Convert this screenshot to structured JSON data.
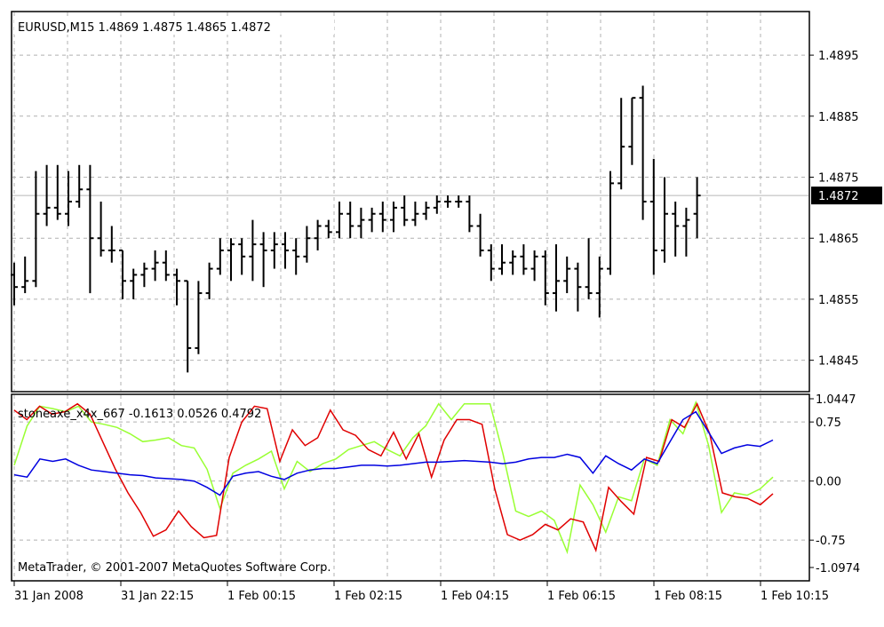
{
  "main_panel": {
    "title": "EURUSD,M15  1.4869 1.4875 1.4865 1.4872",
    "price_ticks": [
      "1.4895",
      "1.4885",
      "1.4875",
      "1.4865",
      "1.4855",
      "1.4845"
    ],
    "current_price": "1.4872"
  },
  "indicator_panel": {
    "title": "stoneaxe_x4x_667 -0.1613 0.0526 0.4792",
    "copyright": "MetaTrader, © 2001-2007 MetaQuotes Software Corp.",
    "ticks": [
      "1.0447",
      "0.75",
      "0.00",
      "-0.75",
      "-1.0974"
    ]
  },
  "time_axis": {
    "labels": [
      "31 Jan 2008",
      "31 Jan 22:15",
      "1 Feb 00:15",
      "1 Feb 02:15",
      "1 Feb 04:15",
      "1 Feb 06:15",
      "1 Feb 08:15",
      "1 Feb 10:15"
    ]
  },
  "colors": {
    "bars": "#000000",
    "grid": "#b0b0b0",
    "current_price_line": "#b8b8b8",
    "red_line": "#e00000",
    "green_line": "#99ff33",
    "blue_line": "#0000e0"
  },
  "chart_data": [
    {
      "type": "ohlc",
      "symbol": "EURUSD",
      "timeframe": "M15",
      "ylim": [
        1.484,
        1.4902
      ],
      "grid": true,
      "bars": [
        {
          "o": 1.4859,
          "h": 1.4861,
          "l": 1.4854,
          "c": 1.4857
        },
        {
          "o": 1.4857,
          "h": 1.4862,
          "l": 1.4856,
          "c": 1.4858
        },
        {
          "o": 1.4858,
          "h": 1.4876,
          "l": 1.4857,
          "c": 1.4869
        },
        {
          "o": 1.4869,
          "h": 1.4877,
          "l": 1.4867,
          "c": 1.487
        },
        {
          "o": 1.487,
          "h": 1.4877,
          "l": 1.4868,
          "c": 1.4869
        },
        {
          "o": 1.4869,
          "h": 1.4876,
          "l": 1.4867,
          "c": 1.4871
        },
        {
          "o": 1.4871,
          "h": 1.4877,
          "l": 1.487,
          "c": 1.4873
        },
        {
          "o": 1.4873,
          "h": 1.4877,
          "l": 1.4856,
          "c": 1.4865
        },
        {
          "o": 1.4865,
          "h": 1.4871,
          "l": 1.4862,
          "c": 1.4863
        },
        {
          "o": 1.4863,
          "h": 1.4867,
          "l": 1.4861,
          "c": 1.4863
        },
        {
          "o": 1.4863,
          "h": 1.4863,
          "l": 1.4855,
          "c": 1.4858
        },
        {
          "o": 1.4858,
          "h": 1.486,
          "l": 1.4855,
          "c": 1.4859
        },
        {
          "o": 1.4859,
          "h": 1.4861,
          "l": 1.4857,
          "c": 1.486
        },
        {
          "o": 1.486,
          "h": 1.4863,
          "l": 1.4858,
          "c": 1.4861
        },
        {
          "o": 1.4861,
          "h": 1.4863,
          "l": 1.4858,
          "c": 1.4859
        },
        {
          "o": 1.4859,
          "h": 1.486,
          "l": 1.4854,
          "c": 1.4858
        },
        {
          "o": 1.4858,
          "h": 1.4858,
          "l": 1.4843,
          "c": 1.4847
        },
        {
          "o": 1.4847,
          "h": 1.4858,
          "l": 1.4846,
          "c": 1.4856
        },
        {
          "o": 1.4856,
          "h": 1.4861,
          "l": 1.4855,
          "c": 1.486
        },
        {
          "o": 1.486,
          "h": 1.4865,
          "l": 1.4859,
          "c": 1.4863
        },
        {
          "o": 1.4863,
          "h": 1.4865,
          "l": 1.4858,
          "c": 1.4864
        },
        {
          "o": 1.4864,
          "h": 1.4865,
          "l": 1.4859,
          "c": 1.4862
        },
        {
          "o": 1.4862,
          "h": 1.4868,
          "l": 1.4858,
          "c": 1.4864
        },
        {
          "o": 1.4864,
          "h": 1.4866,
          "l": 1.4857,
          "c": 1.4863
        },
        {
          "o": 1.4863,
          "h": 1.4866,
          "l": 1.486,
          "c": 1.4864
        },
        {
          "o": 1.4864,
          "h": 1.4866,
          "l": 1.486,
          "c": 1.4863
        },
        {
          "o": 1.4863,
          "h": 1.4865,
          "l": 1.4859,
          "c": 1.4862
        },
        {
          "o": 1.4862,
          "h": 1.4867,
          "l": 1.4861,
          "c": 1.4865
        },
        {
          "o": 1.4865,
          "h": 1.4868,
          "l": 1.4863,
          "c": 1.4867
        },
        {
          "o": 1.4867,
          "h": 1.4868,
          "l": 1.4865,
          "c": 1.4866
        },
        {
          "o": 1.4866,
          "h": 1.4871,
          "l": 1.4865,
          "c": 1.4869
        },
        {
          "o": 1.4869,
          "h": 1.4871,
          "l": 1.4865,
          "c": 1.4867
        },
        {
          "o": 1.4867,
          "h": 1.487,
          "l": 1.4865,
          "c": 1.4868
        },
        {
          "o": 1.4868,
          "h": 1.487,
          "l": 1.4866,
          "c": 1.4869
        },
        {
          "o": 1.4869,
          "h": 1.4871,
          "l": 1.4866,
          "c": 1.4868
        },
        {
          "o": 1.4868,
          "h": 1.4871,
          "l": 1.4866,
          "c": 1.487
        },
        {
          "o": 1.487,
          "h": 1.4872,
          "l": 1.4867,
          "c": 1.4868
        },
        {
          "o": 1.4868,
          "h": 1.4871,
          "l": 1.4867,
          "c": 1.4869
        },
        {
          "o": 1.4869,
          "h": 1.4871,
          "l": 1.4868,
          "c": 1.487
        },
        {
          "o": 1.487,
          "h": 1.4872,
          "l": 1.4869,
          "c": 1.4871
        },
        {
          "o": 1.4871,
          "h": 1.4872,
          "l": 1.487,
          "c": 1.4871
        },
        {
          "o": 1.4871,
          "h": 1.4872,
          "l": 1.487,
          "c": 1.4871
        },
        {
          "o": 1.4871,
          "h": 1.4872,
          "l": 1.4866,
          "c": 1.4867
        },
        {
          "o": 1.4867,
          "h": 1.4869,
          "l": 1.4862,
          "c": 1.4863
        },
        {
          "o": 1.4863,
          "h": 1.4864,
          "l": 1.4858,
          "c": 1.486
        },
        {
          "o": 1.486,
          "h": 1.4864,
          "l": 1.4859,
          "c": 1.4861
        },
        {
          "o": 1.4861,
          "h": 1.4863,
          "l": 1.4859,
          "c": 1.4862
        },
        {
          "o": 1.4862,
          "h": 1.4864,
          "l": 1.4859,
          "c": 1.486
        },
        {
          "o": 1.486,
          "h": 1.4863,
          "l": 1.4858,
          "c": 1.4862
        },
        {
          "o": 1.4862,
          "h": 1.4863,
          "l": 1.4854,
          "c": 1.4856
        },
        {
          "o": 1.4856,
          "h": 1.4864,
          "l": 1.4853,
          "c": 1.4858
        },
        {
          "o": 1.4858,
          "h": 1.4862,
          "l": 1.4856,
          "c": 1.486
        },
        {
          "o": 1.486,
          "h": 1.4861,
          "l": 1.4853,
          "c": 1.4857
        },
        {
          "o": 1.4857,
          "h": 1.4865,
          "l": 1.4855,
          "c": 1.4856
        },
        {
          "o": 1.4856,
          "h": 1.4862,
          "l": 1.4852,
          "c": 1.486
        },
        {
          "o": 1.486,
          "h": 1.4876,
          "l": 1.4859,
          "c": 1.4874
        },
        {
          "o": 1.4874,
          "h": 1.4888,
          "l": 1.4873,
          "c": 1.488
        },
        {
          "o": 1.488,
          "h": 1.4888,
          "l": 1.4877,
          "c": 1.4888
        },
        {
          "o": 1.4888,
          "h": 1.489,
          "l": 1.4868,
          "c": 1.4871
        },
        {
          "o": 1.4871,
          "h": 1.4878,
          "l": 1.4859,
          "c": 1.4863
        },
        {
          "o": 1.4863,
          "h": 1.4875,
          "l": 1.4861,
          "c": 1.4869
        },
        {
          "o": 1.4869,
          "h": 1.4871,
          "l": 1.4862,
          "c": 1.4867
        },
        {
          "o": 1.4867,
          "h": 1.487,
          "l": 1.4862,
          "c": 1.4868
        },
        {
          "o": 1.4869,
          "h": 1.4875,
          "l": 1.4865,
          "c": 1.4872
        }
      ]
    },
    {
      "type": "line",
      "name": "stoneaxe_x4x_667",
      "ylim": [
        -1.0974,
        1.0447
      ],
      "series": [
        {
          "color": "red",
          "values": [
            0.9,
            0.78,
            0.95,
            0.85,
            0.88,
            0.98,
            0.85,
            0.5,
            0.15,
            -0.15,
            -0.4,
            -0.7,
            -0.62,
            -0.38,
            -0.58,
            -0.72,
            -0.69,
            0.3,
            0.75,
            0.95,
            0.92,
            0.25,
            0.65,
            0.45,
            0.55,
            0.9,
            0.65,
            0.58,
            0.4,
            0.32,
            0.62,
            0.28,
            0.6,
            0.05,
            0.52,
            0.78,
            0.78,
            0.72,
            -0.1,
            -0.68,
            -0.75,
            -0.68,
            -0.55,
            -0.62,
            -0.48,
            -0.52,
            -0.88,
            -0.08,
            -0.26,
            -0.42,
            0.3,
            0.25,
            0.78,
            0.68,
            0.98,
            0.6,
            -0.15,
            -0.2,
            -0.22,
            -0.3,
            -0.16
          ]
        },
        {
          "color": "green",
          "values": [
            0.2,
            0.7,
            0.95,
            0.92,
            0.88,
            0.95,
            0.75,
            0.72,
            0.68,
            0.6,
            0.5,
            0.52,
            0.55,
            0.45,
            0.42,
            0.15,
            -0.35,
            0.1,
            0.2,
            0.28,
            0.38,
            -0.1,
            0.25,
            0.12,
            0.22,
            0.28,
            0.4,
            0.45,
            0.5,
            0.4,
            0.32,
            0.55,
            0.7,
            0.98,
            0.78,
            0.98,
            0.98,
            0.98,
            0.35,
            -0.38,
            -0.45,
            -0.38,
            -0.5,
            -0.9,
            -0.05,
            -0.3,
            -0.65,
            -0.2,
            -0.25,
            0.28,
            0.2,
            0.78,
            0.6,
            1.0,
            0.45,
            -0.4,
            -0.15,
            -0.18,
            -0.1,
            0.05
          ]
        },
        {
          "color": "blue",
          "values": [
            0.08,
            0.05,
            0.28,
            0.25,
            0.28,
            0.2,
            0.14,
            0.12,
            0.1,
            0.08,
            0.07,
            0.04,
            0.03,
            0.02,
            0.0,
            -0.08,
            -0.18,
            0.06,
            0.1,
            0.12,
            0.06,
            0.02,
            0.1,
            0.14,
            0.16,
            0.16,
            0.18,
            0.2,
            0.2,
            0.19,
            0.2,
            0.22,
            0.24,
            0.24,
            0.25,
            0.26,
            0.25,
            0.24,
            0.22,
            0.24,
            0.28,
            0.3,
            0.3,
            0.34,
            0.3,
            0.1,
            0.32,
            0.22,
            0.14,
            0.28,
            0.22,
            0.5,
            0.78,
            0.88,
            0.62,
            0.35,
            0.42,
            0.46,
            0.44,
            0.52
          ]
        }
      ]
    }
  ]
}
